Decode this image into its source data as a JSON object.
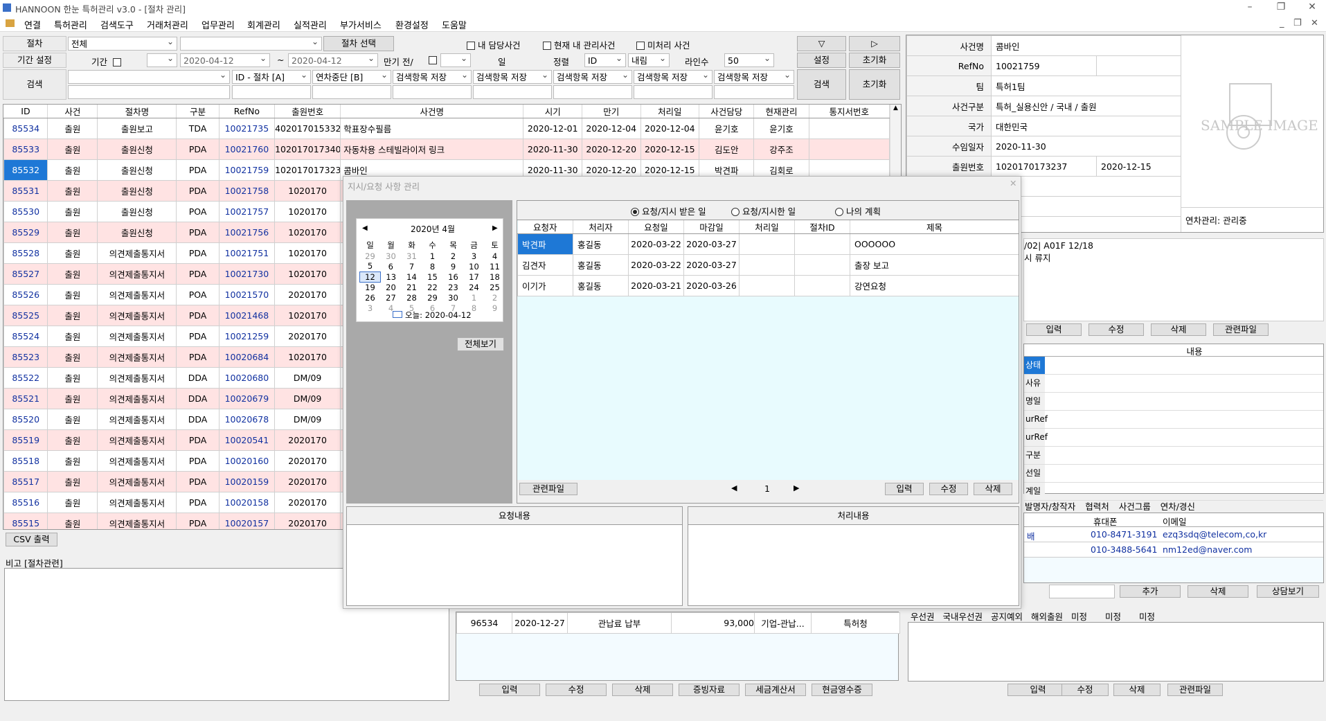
{
  "app": {
    "title": "HANNOON 한눈 특허관리 v3.0 - [절차 관리]"
  },
  "menu": [
    "연결",
    "특허관리",
    "검색도구",
    "거래처관리",
    "업무관리",
    "회계관리",
    "실적관리",
    "부가서비스",
    "환경설정",
    "도움말"
  ],
  "filter": {
    "procedure_label": "절차",
    "procedure_value": "전체",
    "procedure_select_btn": "절차 선택",
    "my_cases": "내 담당사건",
    "current_cases": "현재 내 관리사건",
    "unprocessed": "미처리 사건",
    "period_label": "기간 설정",
    "period": "기간",
    "date_from": "2020-04-12",
    "date_to": "2020-04-12",
    "tilde": "~",
    "due_label": "만기 전/",
    "day_label": "일",
    "sort_label": "정렬",
    "sort_field": "ID",
    "sort_dir": "내림",
    "lines_label": "라인수",
    "lines_value": "50",
    "search_label": "검색",
    "search_field": "ID - 절차 [A]",
    "search_abort": "연차중단 [B]",
    "save_item": "검색항목 저장",
    "btn_down": "▽",
    "btn_right": "▷",
    "btn_set": "설정",
    "btn_reset": "초기화",
    "btn_search": "검색",
    "btn_reset2": "초기화"
  },
  "grid": {
    "headers": [
      "ID",
      "사건",
      "절차명",
      "구분",
      "RefNo",
      "출원번호",
      "사건명",
      "시기",
      "만기",
      "처리일",
      "사건담당",
      "현재관리",
      "통지서번호"
    ],
    "rows": [
      {
        "id": "85534",
        "case": "출원",
        "proc": "출원보고",
        "type": "TDA",
        "ref": "10021735",
        "app": "4020170153321",
        "name": "학표장수필름",
        "t": "2020-12-01",
        "due": "2020-12-04",
        "done": "2020-12-04",
        "owner": "윤기호",
        "cur": "윤기호",
        "pink": false
      },
      {
        "id": "85533",
        "case": "출원",
        "proc": "출원신청",
        "type": "PDA",
        "ref": "10021760",
        "app": "1020170173406",
        "name": "자동차용 스테빌라이저 링크",
        "t": "2020-11-30",
        "due": "2020-12-20",
        "done": "2020-12-15",
        "owner": "김도안",
        "cur": "강주조",
        "pink": true
      },
      {
        "id": "85532",
        "case": "출원",
        "proc": "출원신청",
        "type": "PDA",
        "ref": "10021759",
        "app": "1020170173237",
        "name": "콤바인",
        "t": "2020-11-30",
        "due": "2020-12-20",
        "done": "2020-12-15",
        "owner": "박견파",
        "cur": "김회로",
        "pink": false,
        "sel": true
      },
      {
        "id": "85531",
        "case": "출원",
        "proc": "출원신청",
        "type": "PDA",
        "ref": "10021758",
        "app": "1020170",
        "pink": true
      },
      {
        "id": "85530",
        "case": "출원",
        "proc": "출원신청",
        "type": "POA",
        "ref": "10021757",
        "app": "1020170",
        "pink": false
      },
      {
        "id": "85529",
        "case": "출원",
        "proc": "출원신청",
        "type": "PDA",
        "ref": "10021756",
        "app": "1020170",
        "pink": true
      },
      {
        "id": "85528",
        "case": "출원",
        "proc": "의견제출통지서",
        "type": "PDA",
        "ref": "10021751",
        "app": "1020170",
        "pink": false
      },
      {
        "id": "85527",
        "case": "출원",
        "proc": "의견제출통지서",
        "type": "PDA",
        "ref": "10021730",
        "app": "1020170",
        "pink": true
      },
      {
        "id": "85526",
        "case": "출원",
        "proc": "의견제출통지서",
        "type": "POA",
        "ref": "10021570",
        "app": "2020170",
        "pink": false
      },
      {
        "id": "85525",
        "case": "출원",
        "proc": "의견제출통지서",
        "type": "PDA",
        "ref": "10021468",
        "app": "1020170",
        "pink": true
      },
      {
        "id": "85524",
        "case": "출원",
        "proc": "의견제출통지서",
        "type": "PDA",
        "ref": "10021259",
        "app": "2020170",
        "pink": false
      },
      {
        "id": "85523",
        "case": "출원",
        "proc": "의견제출통지서",
        "type": "PDA",
        "ref": "10020684",
        "app": "1020170",
        "pink": true
      },
      {
        "id": "85522",
        "case": "출원",
        "proc": "의견제출통지서",
        "type": "DDA",
        "ref": "10020680",
        "app": "DM/09",
        "pink": false
      },
      {
        "id": "85521",
        "case": "출원",
        "proc": "의견제출통지서",
        "type": "DDA",
        "ref": "10020679",
        "app": "DM/09",
        "pink": true
      },
      {
        "id": "85520",
        "case": "출원",
        "proc": "의견제출통지서",
        "type": "DDA",
        "ref": "10020678",
        "app": "DM/09",
        "pink": false
      },
      {
        "id": "85519",
        "case": "출원",
        "proc": "의견제출통지서",
        "type": "PDA",
        "ref": "10020541",
        "app": "2020170",
        "pink": true
      },
      {
        "id": "85518",
        "case": "출원",
        "proc": "의견제출통지서",
        "type": "PDA",
        "ref": "10020160",
        "app": "2020170",
        "pink": false
      },
      {
        "id": "85517",
        "case": "출원",
        "proc": "의견제출통지서",
        "type": "PDA",
        "ref": "10020159",
        "app": "2020170",
        "pink": true
      },
      {
        "id": "85516",
        "case": "출원",
        "proc": "의견제출통지서",
        "type": "PDA",
        "ref": "10020158",
        "app": "2020170",
        "pink": false
      },
      {
        "id": "85515",
        "case": "출원",
        "proc": "의견제출통지서",
        "type": "PDA",
        "ref": "10020157",
        "app": "2020170",
        "pink": true
      }
    ]
  },
  "left_bottom": {
    "csv": "CSV 출력",
    "memo_label": "비고 [절차관련]"
  },
  "case_info": {
    "name_k": "사건명",
    "name_v": "콤바인",
    "ref_k": "RefNo",
    "ref_v": "10021759",
    "team_k": "팀",
    "team_v": "특허1팀",
    "kind_k": "사건구분",
    "kind_v": "특허_실용신안 / 국내 / 출원",
    "country_k": "국가",
    "country_v": "대한민국",
    "recv_k": "수임일자",
    "recv_v": "2020-11-30",
    "appno_k": "출원번호",
    "appno_v": "1020170173237",
    "appdate_v": "2020-12-15",
    "annual": "연차관리: 관리중",
    "sample": "SAMPLE IMAGE",
    "memo1": "/02| A01F 12/18",
    "memo2": "시 류지"
  },
  "right_btns": {
    "input": "입력",
    "edit": "수정",
    "del": "삭제",
    "files": "관련파일"
  },
  "content_panel": {
    "header": "내용",
    "items": [
      "상태",
      "사유",
      "명일",
      "urRef",
      "urRef",
      "구분",
      "선일",
      "계일"
    ]
  },
  "contacts": {
    "tabs": [
      "발명자/창작자",
      "협력처",
      "사건그룹",
      "연차/경신"
    ],
    "headers": [
      "휴대폰",
      "이메일"
    ],
    "rows": [
      {
        "n": "배",
        "phone": "010-8471-3191",
        "email": "ezq3sdq@telecom,co,kr"
      },
      {
        "n": "",
        "phone": "010-3488-5641",
        "email": "nm12ed@naver.com"
      }
    ],
    "add": "추가",
    "del": "삭제",
    "consult": "상담보기"
  },
  "right_tabs": [
    "우선권",
    "국내우선권",
    "공지예외",
    "해외출원",
    "미정",
    "미정",
    "미정"
  ],
  "fee": {
    "row": [
      "96534",
      "2020-12-27",
      "관납료 납부",
      "93,000",
      "기업-관납...",
      "특허청"
    ],
    "btns": [
      "입력",
      "수정",
      "삭제",
      "증빙자료",
      "세금계산서",
      "현금영수증"
    ]
  },
  "modal": {
    "title": "지시/요청 사항 관리",
    "radios": [
      "요청/지시 받은 일",
      "요청/지시한 일",
      "나의 계획"
    ],
    "cal": {
      "month": "2020년 4월",
      "dow": [
        "일",
        "월",
        "화",
        "수",
        "목",
        "금",
        "토"
      ],
      "weeks": [
        [
          "29",
          "30",
          "31",
          "1",
          "2",
          "3",
          "4"
        ],
        [
          "5",
          "6",
          "7",
          "8",
          "9",
          "10",
          "11"
        ],
        [
          "12",
          "13",
          "14",
          "15",
          "16",
          "17",
          "18"
        ],
        [
          "19",
          "20",
          "21",
          "22",
          "23",
          "24",
          "25"
        ],
        [
          "26",
          "27",
          "28",
          "29",
          "30",
          "1",
          "2"
        ],
        [
          "3",
          "4",
          "5",
          "6",
          "7",
          "8",
          "9"
        ]
      ],
      "today": "오늘: 2020-04-12"
    },
    "viewall": "전체보기",
    "headers": [
      "요청자",
      "처리자",
      "요청일",
      "마감일",
      "처리일",
      "절차ID",
      "제목"
    ],
    "rows": [
      {
        "req": "박견파",
        "han": "홍길동",
        "rd": "2020-03-22",
        "dd": "2020-03-27",
        "pd": "",
        "pid": "",
        "title": "OOOOOO"
      },
      {
        "req": "김견자",
        "han": "홍길동",
        "rd": "2020-03-22",
        "dd": "2020-03-27",
        "pd": "",
        "pid": "",
        "title": "출장 보고"
      },
      {
        "req": "이기가",
        "han": "홍길동",
        "rd": "2020-03-21",
        "dd": "2020-03-26",
        "pd": "",
        "pid": "",
        "title": "강연요청"
      }
    ],
    "files": "관련파일",
    "page": "1",
    "input": "입력",
    "edit": "수정",
    "del": "삭제",
    "req_content": "요청내용",
    "proc_content": "처리내용"
  }
}
